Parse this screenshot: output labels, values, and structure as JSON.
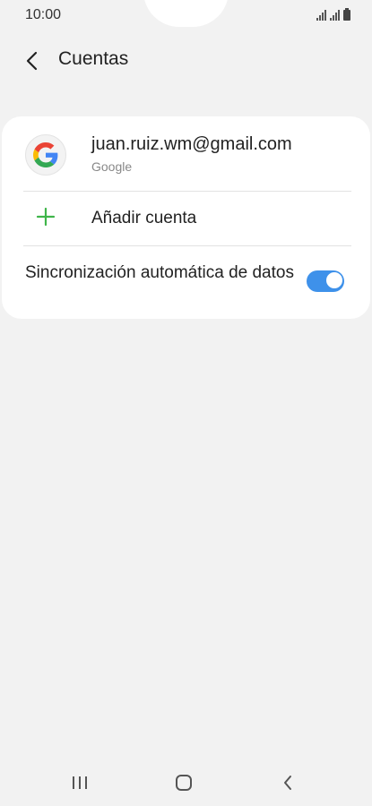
{
  "status_bar": {
    "time": "10:00",
    "icons": [
      "signal-icon",
      "signal-icon",
      "battery-icon"
    ]
  },
  "header": {
    "back_icon": "chevron-left-icon",
    "title": "Cuentas"
  },
  "accounts": [
    {
      "email": "juan.ruiz.wm@gmail.com",
      "type": "Google",
      "icon": "google-logo-icon"
    }
  ],
  "add_account": {
    "label": "Añadir cuenta",
    "icon": "plus-icon",
    "icon_color": "#3fb54a"
  },
  "sync": {
    "label": "Sincronización automática de datos",
    "enabled": true,
    "accent_color": "#3e91ea"
  },
  "nav_bar": {
    "icons": [
      "recents-icon",
      "home-icon",
      "back-icon"
    ]
  }
}
